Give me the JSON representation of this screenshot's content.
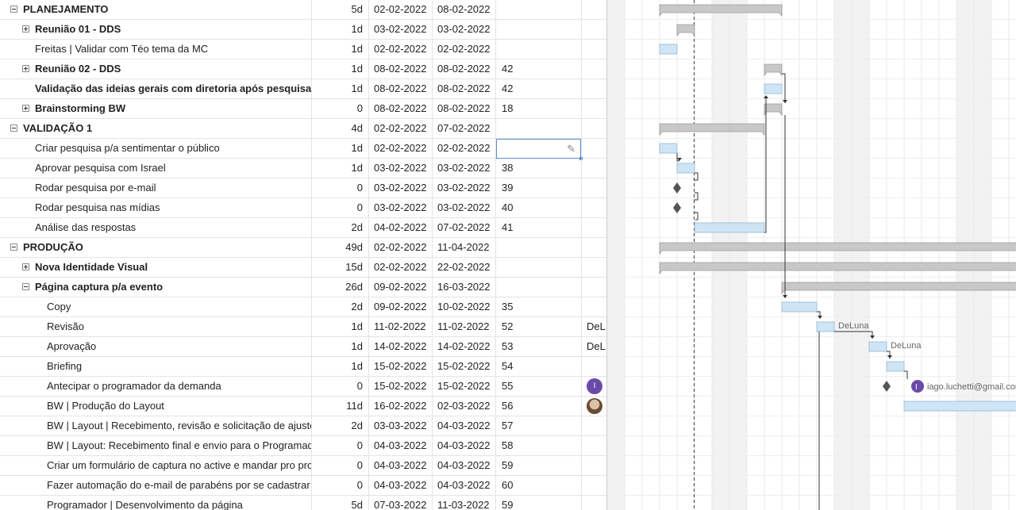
{
  "tasks": [
    {
      "name": "PLANEJAMENTO",
      "level": 0,
      "toggle": "minus",
      "bold": true,
      "duration": "5d",
      "start": "02-02-2022",
      "end": "08-02-2022",
      "pred": "",
      "res": ""
    },
    {
      "name": "Reunião 01 - DDS",
      "level": 1,
      "toggle": "plus",
      "bold": true,
      "duration": "1d",
      "start": "03-02-2022",
      "end": "03-02-2022",
      "pred": "",
      "res": ""
    },
    {
      "name": "Freitas | Validar com Téo tema da MC",
      "level": 1,
      "toggle": "",
      "bold": false,
      "duration": "1d",
      "start": "02-02-2022",
      "end": "02-02-2022",
      "pred": "",
      "res": ""
    },
    {
      "name": "Reunião 02 - DDS",
      "level": 1,
      "toggle": "plus",
      "bold": true,
      "duration": "1d",
      "start": "08-02-2022",
      "end": "08-02-2022",
      "pred": "42",
      "res": ""
    },
    {
      "name": "Validação das ideias gerais com diretoria após pesquisa",
      "level": 1,
      "toggle": "",
      "bold": true,
      "duration": "1d",
      "start": "08-02-2022",
      "end": "08-02-2022",
      "pred": "42",
      "res": ""
    },
    {
      "name": "Brainstorming BW",
      "level": 1,
      "toggle": "plus",
      "bold": true,
      "duration": "0",
      "start": "08-02-2022",
      "end": "08-02-2022",
      "pred": "18",
      "res": ""
    },
    {
      "name": "VALIDAÇÃO 1",
      "level": 0,
      "toggle": "minus",
      "bold": true,
      "duration": "4d",
      "start": "02-02-2022",
      "end": "07-02-2022",
      "pred": "",
      "res": ""
    },
    {
      "name": "Criar pesquisa p/a sentimentar o público",
      "level": 1,
      "toggle": "",
      "bold": false,
      "duration": "1d",
      "start": "02-02-2022",
      "end": "02-02-2022",
      "pred": "",
      "res": "",
      "editing": true
    },
    {
      "name": "Aprovar pesquisa com Israel",
      "level": 1,
      "toggle": "",
      "bold": false,
      "duration": "1d",
      "start": "03-02-2022",
      "end": "03-02-2022",
      "pred": "38",
      "res": ""
    },
    {
      "name": "Rodar pesquisa por e-mail",
      "level": 1,
      "toggle": "",
      "bold": false,
      "duration": "0",
      "start": "03-02-2022",
      "end": "03-02-2022",
      "pred": "39",
      "res": ""
    },
    {
      "name": "Rodar pesquisa nas mídias",
      "level": 1,
      "toggle": "",
      "bold": false,
      "duration": "0",
      "start": "03-02-2022",
      "end": "03-02-2022",
      "pred": "40",
      "res": ""
    },
    {
      "name": "Análise das respostas",
      "level": 1,
      "toggle": "",
      "bold": false,
      "duration": "2d",
      "start": "04-02-2022",
      "end": "07-02-2022",
      "pred": "41",
      "res": ""
    },
    {
      "name": "PRODUÇÃO",
      "level": 0,
      "toggle": "minus",
      "bold": true,
      "duration": "49d",
      "start": "02-02-2022",
      "end": "11-04-2022",
      "pred": "",
      "res": ""
    },
    {
      "name": "Nova Identidade Visual",
      "level": 1,
      "toggle": "plus",
      "bold": true,
      "duration": "15d",
      "start": "02-02-2022",
      "end": "22-02-2022",
      "pred": "",
      "res": ""
    },
    {
      "name": "Página captura p/a evento",
      "level": 1,
      "toggle": "minus",
      "bold": true,
      "duration": "26d",
      "start": "09-02-2022",
      "end": "16-03-2022",
      "pred": "",
      "res": ""
    },
    {
      "name": "Copy",
      "level": 2,
      "toggle": "",
      "bold": false,
      "duration": "2d",
      "start": "09-02-2022",
      "end": "10-02-2022",
      "pred": "35",
      "res": ""
    },
    {
      "name": "Revisão",
      "level": 2,
      "toggle": "",
      "bold": false,
      "duration": "1d",
      "start": "11-02-2022",
      "end": "11-02-2022",
      "pred": "52",
      "res": "DeL"
    },
    {
      "name": "Aprovação",
      "level": 2,
      "toggle": "",
      "bold": false,
      "duration": "1d",
      "start": "14-02-2022",
      "end": "14-02-2022",
      "pred": "53",
      "res": "DeL"
    },
    {
      "name": "Briefing",
      "level": 2,
      "toggle": "",
      "bold": false,
      "duration": "1d",
      "start": "15-02-2022",
      "end": "15-02-2022",
      "pred": "54",
      "res": ""
    },
    {
      "name": "Antecipar o programador da demanda",
      "level": 2,
      "toggle": "",
      "bold": false,
      "duration": "0",
      "start": "15-02-2022",
      "end": "15-02-2022",
      "pred": "55",
      "res": "",
      "avatar": "I"
    },
    {
      "name": "BW | Produção do Layout",
      "level": 2,
      "toggle": "",
      "bold": false,
      "duration": "11d",
      "start": "16-02-2022",
      "end": "02-03-2022",
      "pred": "56",
      "res": "",
      "avatar_photo": true
    },
    {
      "name": "BW | Layout | Recebimento, revisão e solicitação de ajustes",
      "level": 2,
      "toggle": "",
      "bold": false,
      "duration": "2d",
      "start": "03-03-2022",
      "end": "04-03-2022",
      "pred": "57",
      "res": ""
    },
    {
      "name": "BW | Layout: Recebimento final e envio para o Programador",
      "level": 2,
      "toggle": "",
      "bold": false,
      "duration": "0",
      "start": "04-03-2022",
      "end": "04-03-2022",
      "pred": "58",
      "res": ""
    },
    {
      "name": "Criar um formulário de captura no active e mandar pro programador",
      "level": 2,
      "toggle": "",
      "bold": false,
      "duration": "0",
      "start": "04-03-2022",
      "end": "04-03-2022",
      "pred": "59",
      "res": ""
    },
    {
      "name": "Fazer automação do e-mail de parabéns por se cadastrar",
      "level": 2,
      "toggle": "",
      "bold": false,
      "duration": "0",
      "start": "04-03-2022",
      "end": "04-03-2022",
      "pred": "60",
      "res": ""
    },
    {
      "name": "Programador | Desenvolvimento da página",
      "level": 2,
      "toggle": "",
      "bold": false,
      "duration": "5d",
      "start": "07-03-2022",
      "end": "11-03-2022",
      "pred": "59",
      "res": ""
    }
  ],
  "gantt": {
    "labels": {
      "revisao": "DeLuna",
      "aprovacao": "DeLuna",
      "antecipar_user": "iago.luchetti@gmail.com",
      "antecipar_avatar": "I"
    },
    "colors": {
      "summary_bar": "#c8c8c8",
      "task_bar": "#cfe5f5",
      "task_border": "#8fb8d8",
      "milestone": "#555555",
      "weekend": "#f2f2f2",
      "avatar": "#6a4aa8"
    }
  }
}
